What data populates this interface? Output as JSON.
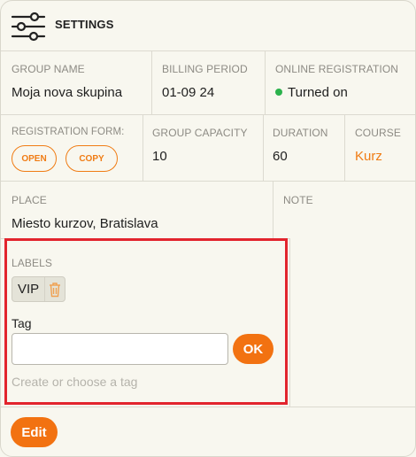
{
  "header": {
    "title": "SETTINGS",
    "icon": "sliders-icon"
  },
  "row1": {
    "group_name": {
      "label": "GROUP NAME",
      "value": "Moja nova skupina"
    },
    "billing_period": {
      "label": "BILLING PERIOD",
      "value": "01-09 24"
    },
    "online_registration": {
      "label": "ONLINE REGISTRATION",
      "value": "Turned on",
      "status_color": "#2bb24c"
    }
  },
  "row2": {
    "registration_form": {
      "label": "REGISTRATION FORM:",
      "open_label": "OPEN",
      "copy_label": "COPY"
    },
    "group_capacity": {
      "label": "GROUP CAPACITY",
      "value": "10"
    },
    "duration": {
      "label": "DURATION",
      "value": "60"
    },
    "course": {
      "label": "COURSE",
      "value": "Kurz"
    }
  },
  "row3": {
    "place": {
      "label": "PLACE",
      "value": "Miesto kurzov, Bratislava"
    },
    "note": {
      "label": "NOTE",
      "value": ""
    }
  },
  "labels": {
    "heading": "LABELS",
    "chips": [
      {
        "text": "VIP",
        "icon": "trash-icon"
      }
    ],
    "tag_label": "Tag",
    "tag_value": "",
    "ok_label": "OK",
    "hint": "Create or choose a tag"
  },
  "footer": {
    "edit_label": "Edit"
  },
  "colors": {
    "accent": "#f27211",
    "highlight": "#e2242d",
    "background": "#f8f7ef"
  }
}
